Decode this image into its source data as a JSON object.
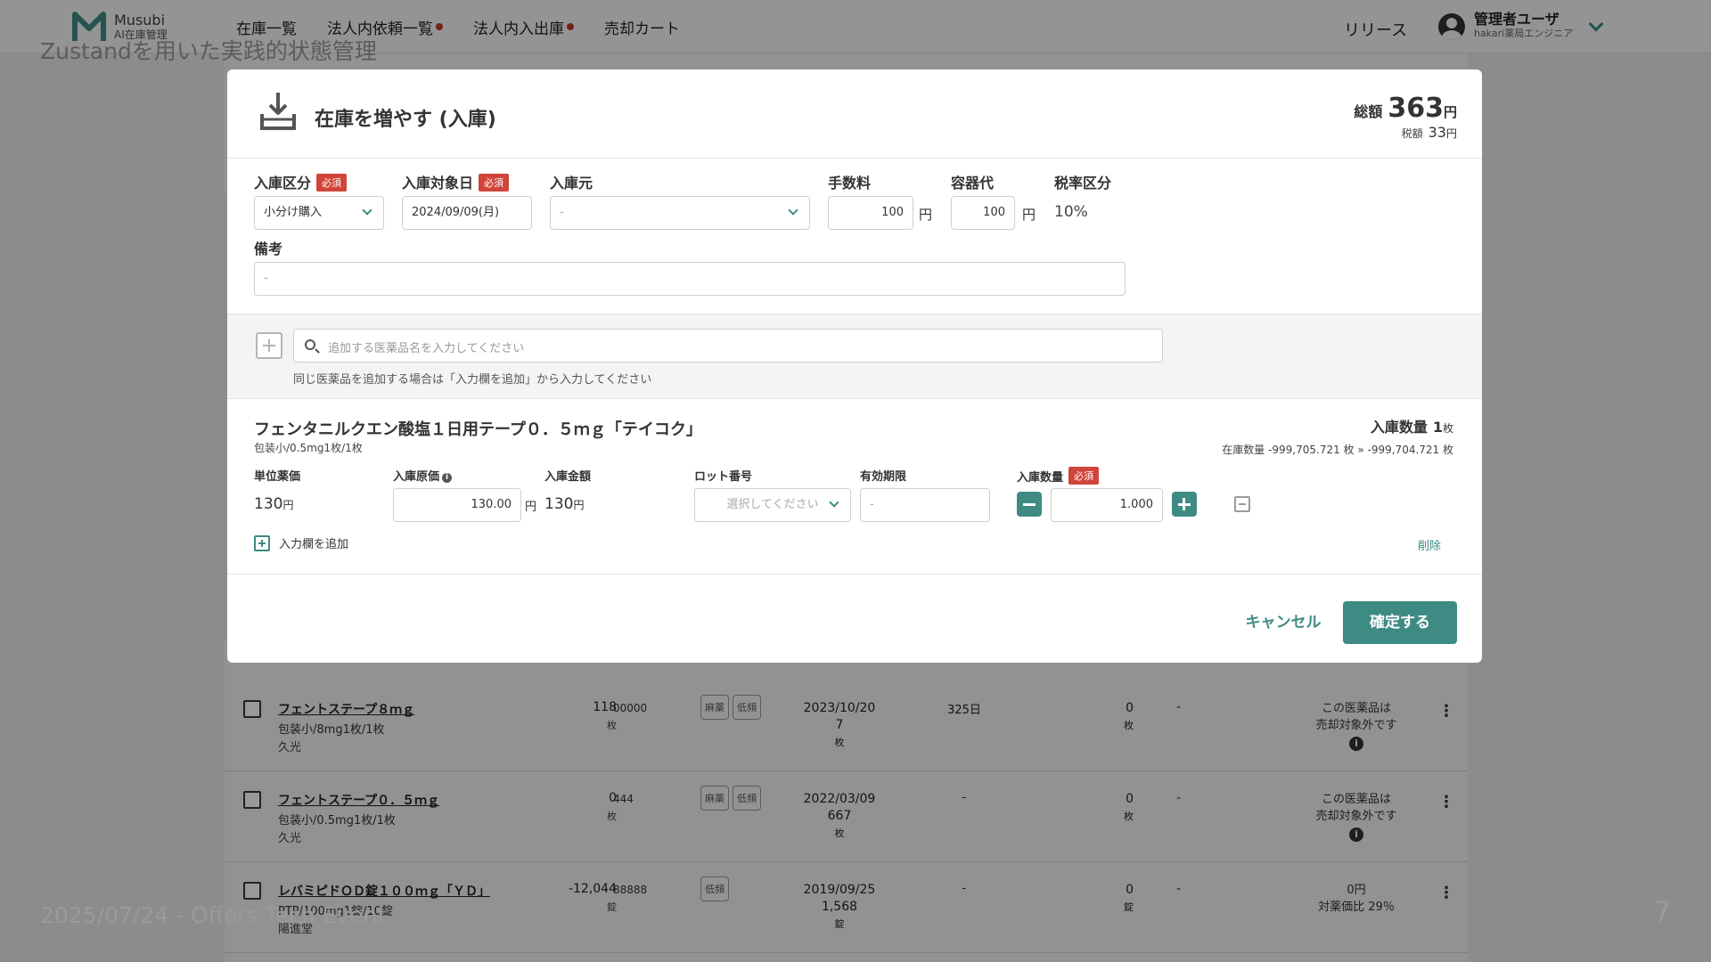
{
  "slide": {
    "title": "Zustandを用いた実践的状態管理",
    "footer": "2025/07/24 - Offers Tech Event",
    "number": "7"
  },
  "app": {
    "logo_name": "Musubi",
    "logo_sub": "AI在庫管理",
    "nav": [
      {
        "label": "在庫一覧",
        "dot": false
      },
      {
        "label": "法人内依頼一覧",
        "dot": true
      },
      {
        "label": "法人内入出庫",
        "dot": true
      },
      {
        "label": "売却カート",
        "dot": false
      }
    ],
    "release": "リリース",
    "user_name": "管理者ユーザ",
    "user_role": "hakari薬局エンジニア"
  },
  "colors": {
    "accent": "#3e8b84",
    "required": "#d0443a"
  },
  "modal": {
    "title": "在庫を増やす (入庫)",
    "total_label": "総額",
    "total_value": "363",
    "total_unit": "円",
    "tax_label": "税額",
    "tax_value": "33",
    "tax_unit": "円",
    "required_badge": "必須",
    "form": {
      "type_label": "入庫区分",
      "type_value": "小分け購入",
      "date_label": "入庫対象日",
      "date_value": "2024/09/09(月)",
      "source_label": "入庫元",
      "source_value": "-",
      "fee_label": "手数料",
      "fee_value": "100",
      "container_label": "容器代",
      "container_value": "100",
      "yen": "円",
      "tax_class_label": "税率区分",
      "tax_class_value": "10%",
      "note_label": "備考",
      "note_value": "-"
    },
    "search": {
      "placeholder": "追加する医薬品名を入力してください",
      "hint": "同じ医薬品を追加する場合は「入力欄を追加」から入力してください"
    },
    "item": {
      "name": "フェンタニルクエン酸塩１日用テープ０．５ｍｇ「テイコク」",
      "package": "包装小/0.5mg1枚/1枚",
      "qty_label": "入庫数量",
      "qty_value": "1",
      "qty_unit": "枚",
      "stock_line": "在庫数量 -999,705.721 枚 » -999,704.721 枚",
      "unit_price_label": "単位薬価",
      "unit_price_value": "130",
      "cost_label": "入庫原価",
      "cost_value": "130.00",
      "amount_label": "入庫金額",
      "amount_value": "130",
      "lot_label": "ロット番号",
      "lot_placeholder": "選択してください",
      "expiry_label": "有効期限",
      "expiry_value": "-",
      "in_qty_label": "入庫数量",
      "in_qty_value": "1.000",
      "add_row": "入力欄を追加",
      "delete": "削除"
    },
    "cancel": "キャンセル",
    "confirm": "確定する"
  },
  "background_rows": [
    {
      "name": "フェントステープ８ｍｇ",
      "pack": "包装小/8mg1枚/1枚",
      "maker": "久光",
      "qty": "118",
      "unit": "枚",
      "code": "00000",
      "tags": [
        "麻薬",
        "低頻"
      ],
      "date": "2023/10/20",
      "date2": "7",
      "date_unit": "枚",
      "days": "325日",
      "zero": "0",
      "zero_unit": "枚",
      "dash": "-",
      "note1": "この医薬品は",
      "note2": "売却対象外です"
    },
    {
      "name": "フェントステープ０．５ｍｇ",
      "pack": "包装小/0.5mg1枚/1枚",
      "maker": "久光",
      "qty": "0",
      "unit": "枚",
      "code": "444",
      "tags": [
        "麻薬",
        "低頻"
      ],
      "date": "2022/03/09",
      "date2": "667",
      "date_unit": "枚",
      "days": "-",
      "zero": "0",
      "zero_unit": "枚",
      "dash": "-",
      "note1": "この医薬品は",
      "note2": "売却対象外です"
    },
    {
      "name": "レバミピドＯＤ錠１００ｍｇ「ＹＤ」",
      "pack": "PTP/100mg1錠/10錠",
      "maker": "陽進堂",
      "qty": "-12,044",
      "unit": "錠",
      "code": "88888",
      "tags": [
        "低頻"
      ],
      "date": "2019/09/25",
      "date2": "1,568",
      "date_unit": "錠",
      "days": "-",
      "zero": "0",
      "zero_unit": "錠",
      "dash": "-",
      "note1": "0円",
      "note2": "対薬価比 29％"
    }
  ]
}
